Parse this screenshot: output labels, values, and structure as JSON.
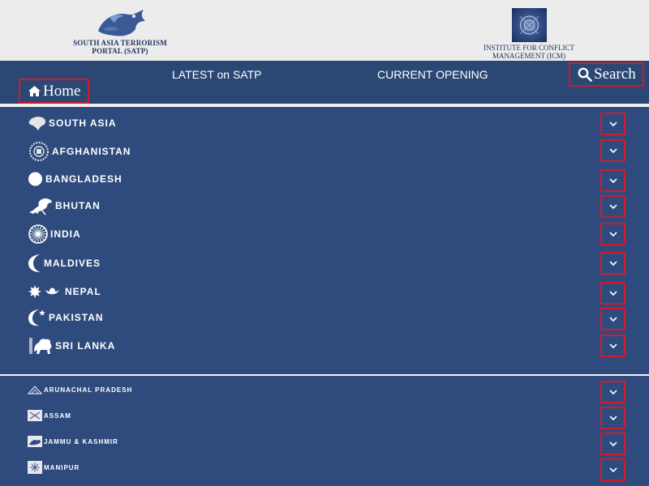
{
  "header": {
    "satp_logo": {
      "line1": "SOUTH ASIA TERRORISM",
      "line2": "PORTAL (SATP)"
    },
    "icm_logo": {
      "line1": "INSTITUTE FOR CONFLICT",
      "line2": "MANAGEMENT (ICM)"
    }
  },
  "nav": {
    "latest_label": "LATEST on SATP",
    "opening_label": "CURRENT OPENING",
    "search_label": "Search",
    "home_label": "Home"
  },
  "countries": [
    {
      "label": "SOUTH ASIA",
      "icon": "south-asia-map-icon"
    },
    {
      "label": "AFGHANISTAN",
      "icon": "afghanistan-emblem-icon"
    },
    {
      "label": "BANGLADESH",
      "icon": "bangladesh-disc-icon"
    },
    {
      "label": "BHUTAN",
      "icon": "bhutan-dragon-icon"
    },
    {
      "label": "INDIA",
      "icon": "ashoka-chakra-icon"
    },
    {
      "label": "MALDIVES",
      "icon": "crescent-icon"
    },
    {
      "label": "NEPAL",
      "icon": "nepal-sun-moon-icon"
    },
    {
      "label": "PAKISTAN",
      "icon": "crescent-star-icon"
    },
    {
      "label": "SRI LANKA",
      "icon": "lion-icon"
    }
  ],
  "states": [
    {
      "label": "ARUNACHAL PRADESH",
      "icon": "arunachal-emblem-icon"
    },
    {
      "label": "ASSAM",
      "icon": "assam-emblem-icon"
    },
    {
      "label": "JAMMU & KASHMIR",
      "icon": "jk-emblem-icon"
    },
    {
      "label": "MANIPUR",
      "icon": "manipur-emblem-icon"
    }
  ],
  "colors": {
    "nav_bg": "#2b4875",
    "panel_bg": "#2f4b7d",
    "header_bg": "#ececec",
    "focus_outline": "#d21a2a"
  }
}
